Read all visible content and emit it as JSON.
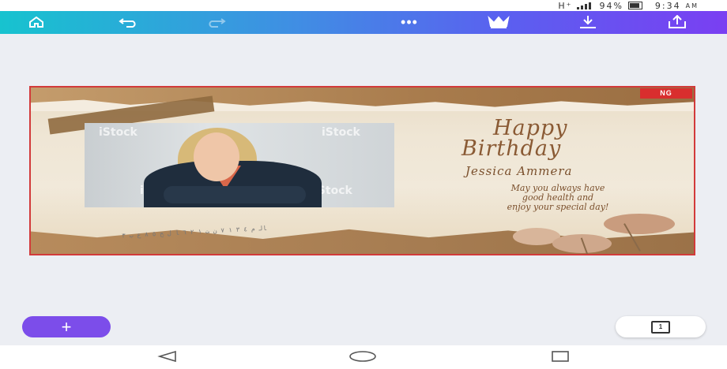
{
  "status_bar": {
    "network": "H⁺",
    "battery": "94%",
    "time": "9:34",
    "ampm": "AM"
  },
  "toolbar": {
    "home_icon": "home-icon",
    "undo_icon": "undo-icon",
    "redo_icon": "redo-icon",
    "more_icon": "more-icon",
    "crown_icon": "crown-icon",
    "download_icon": "download-icon",
    "share_icon": "share-icon",
    "gradient_start": "#17c3cf",
    "gradient_end": "#7a3ff2"
  },
  "canvas": {
    "border_color": "#d23a3a",
    "badge": "NG",
    "photo_watermark": "iStock",
    "title_line1": "Happy",
    "title_line2": "Birthday",
    "name": "Jessica Ammera",
    "message_line1": "May you always have",
    "message_line2": "good health and",
    "message_line3": "enjoy your special day!",
    "text_color": "#8a5a34"
  },
  "fab": {
    "label": "+",
    "color": "#7c4dea"
  },
  "pages_button": {
    "count": "1"
  },
  "navbar": {
    "back_icon": "back-triangle-icon",
    "home_icon": "home-circle-icon",
    "recents_icon": "recents-square-icon"
  }
}
